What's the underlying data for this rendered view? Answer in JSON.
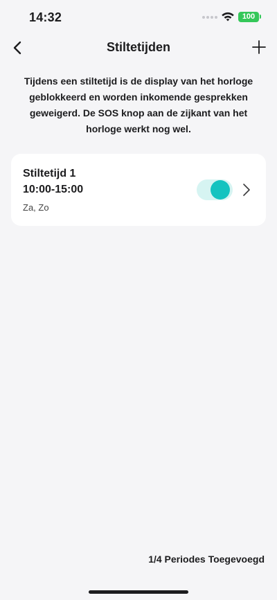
{
  "status_bar": {
    "time": "14:32",
    "battery": "100",
    "battery_color": "#34c759",
    "icons": [
      "signal-dots-icon",
      "wifi-icon",
      "battery-icon"
    ]
  },
  "nav": {
    "title": "Stiltetijden",
    "back_icon": "chevron-left-icon",
    "add_icon": "plus-icon"
  },
  "intro": "Tijdens een stiltetijd is de display van het horloge geblokkeerd en worden inkomende gesprekken geweigerd. De SOS knop aan de zijkant van het horloge werkt nog wel.",
  "periods": [
    {
      "name": "Stiltetijd 1",
      "time": "10:00-15:00",
      "days": "Za, Zo",
      "enabled": true,
      "toggle_color": "#14c3c0"
    }
  ],
  "footer": {
    "count_text": "1/4 Periodes Toegevoegd"
  }
}
